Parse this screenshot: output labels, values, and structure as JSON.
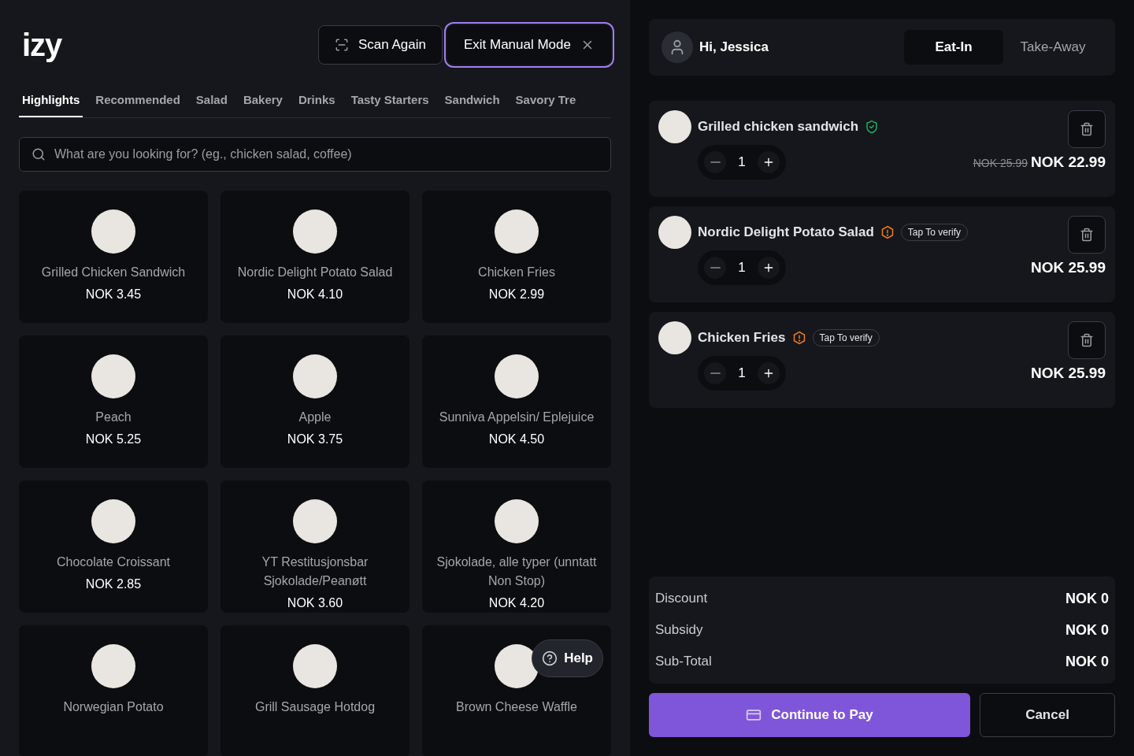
{
  "logo": "izy",
  "header_buttons": [
    {
      "kind": "scan",
      "label": "Scan Again",
      "highlighted": false
    },
    {
      "kind": "exit",
      "label": "Exit Manual Mode",
      "highlighted": true
    }
  ],
  "tabs": [
    {
      "label": "Highlights",
      "selected": true
    },
    {
      "label": "Recommended",
      "selected": false
    },
    {
      "label": "Salad",
      "selected": false
    },
    {
      "label": "Bakery",
      "selected": false
    },
    {
      "label": "Drinks",
      "selected": false
    },
    {
      "label": "Tasty Starters",
      "selected": false
    },
    {
      "label": "Sandwich",
      "selected": false
    },
    {
      "label": "Savory Tre",
      "selected": false
    }
  ],
  "search": {
    "placeholder": "What are you looking for? (eg., chicken salad, coffee)"
  },
  "products": [
    {
      "name": "Grilled Chicken Sandwich",
      "price": "NOK 3.45"
    },
    {
      "name": "Nordic Delight Potato Salad",
      "price": "NOK 4.10"
    },
    {
      "name": "Chicken Fries",
      "price": "NOK 2.99"
    },
    {
      "name": "Peach",
      "price": "NOK 5.25"
    },
    {
      "name": "Apple",
      "price": "NOK 3.75"
    },
    {
      "name": "Sunniva Appelsin/ Eplejuice",
      "price": "NOK 4.50"
    },
    {
      "name": "Chocolate Croissant",
      "price": "NOK 2.85"
    },
    {
      "name": "YT Restitusjonsbar Sjokolade/Peanøtt",
      "price": "NOK 3.60"
    },
    {
      "name": "Sjokolade, alle typer (unntatt Non Stop)",
      "price": "NOK 4.20"
    },
    {
      "name": "Norwegian Potato"
    },
    {
      "name": "Grill Sausage Hotdog"
    },
    {
      "name": "Brown Cheese Waffle"
    }
  ],
  "help": {
    "label": "Help"
  },
  "cart": {
    "greeting": "Hi, Jessica",
    "order_types": [
      {
        "label": "Eat-In",
        "selected": true
      },
      {
        "label": "Take-Away",
        "selected": false
      }
    ],
    "items": [
      {
        "name": "Grilled chicken sandwich",
        "verified": true,
        "quantity": "1",
        "old_price": "NOK 25.99",
        "price": "NOK 22.99"
      },
      {
        "name": "Nordic Delight Potato Salad",
        "verified": false,
        "badge": "Tap To verify",
        "quantity": "1",
        "price": "NOK 25.99"
      },
      {
        "name": "Chicken Fries",
        "verified": false,
        "badge": "Tap To verify",
        "quantity": "1",
        "price": "NOK 25.99"
      }
    ],
    "summary": [
      {
        "label": "Discount",
        "value": "NOK 0"
      },
      {
        "label": "Subsidy",
        "value": "NOK 0"
      },
      {
        "label": "Sub-Total",
        "value": "NOK 0"
      }
    ],
    "pay_button": "Continue to Pay",
    "cancel_button": "Cancel"
  }
}
